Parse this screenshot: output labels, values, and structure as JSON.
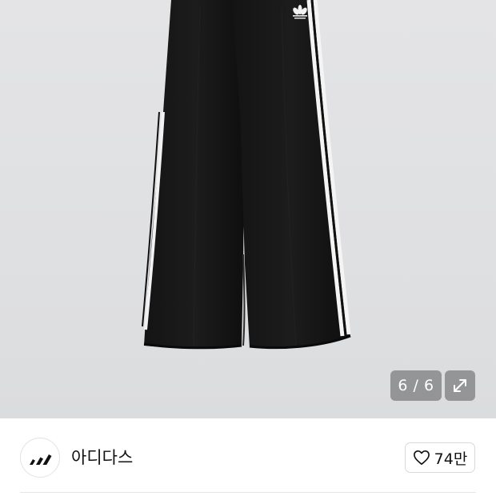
{
  "gallery": {
    "counter": "6 / 6",
    "image_icon": "trefoil-pants-photo",
    "expand_icon": "expand-diagonal-icon"
  },
  "seller": {
    "name": "아디다스",
    "avatar_icon": "adidas-logo",
    "like_icon": "heart-outline-icon",
    "like_count": "74만"
  },
  "colors": {
    "gallery_bg": "#e1e2e4",
    "pants": "#111111",
    "stripes": "#f4f4f4",
    "overlay": "#78787c"
  }
}
